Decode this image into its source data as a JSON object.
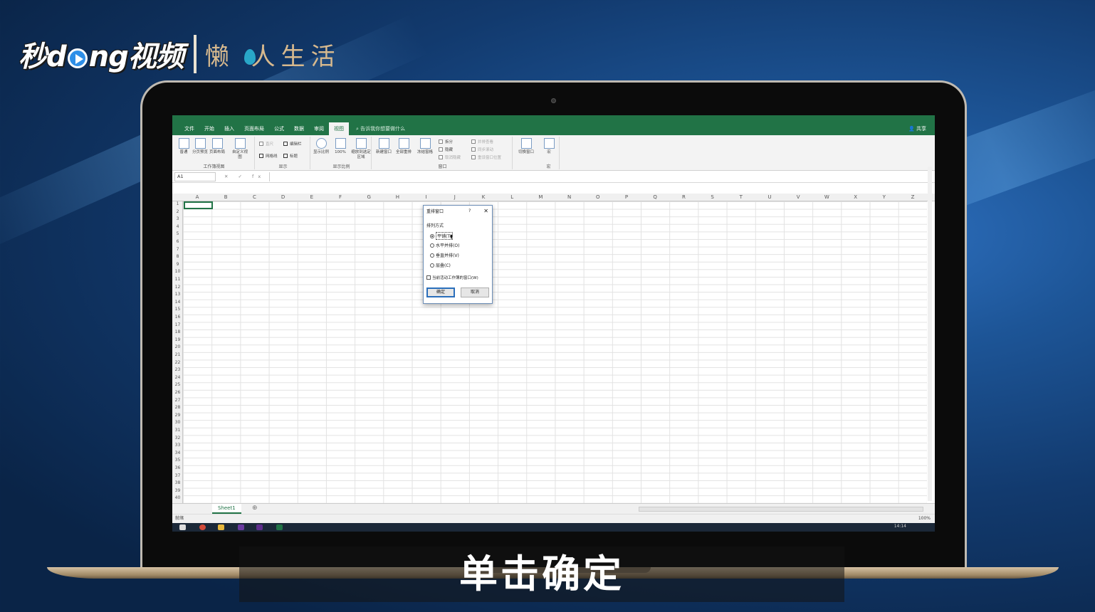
{
  "brand": {
    "main_a": "秒d",
    "main_b": "ng视频",
    "sub_a": "懒",
    "sub_b": "人生活"
  },
  "caption": "单击确定",
  "excel": {
    "tabs": [
      "文件",
      "开始",
      "插入",
      "页面布局",
      "公式",
      "数据",
      "审阅",
      "视图"
    ],
    "active_tab": "视图",
    "tell_me": "告诉我你想要做什么",
    "share": "共享",
    "ribbon": {
      "workbook_views": {
        "label": "工作簿视图",
        "normal": "普通",
        "page_break": "分页预览",
        "page_layout": "页面布局",
        "custom": "自定义视图"
      },
      "show": {
        "label": "显示",
        "ruler": "直尺",
        "formula_bar": "编辑栏",
        "gridlines": "网格线",
        "headings": "标题"
      },
      "zoom": {
        "label": "显示比例",
        "zoom": "显示比例",
        "hundred": "100%",
        "to_selection": "缩放到选定区域"
      },
      "window": {
        "label": "窗口",
        "new_window": "新建窗口",
        "arrange_all": "全部重排",
        "freeze": "冻结窗格",
        "split": "拆分",
        "hide": "隐藏",
        "unhide": "取消隐藏",
        "side_by_side": "并排查看",
        "sync_scroll": "同步滚动",
        "reset_pos": "重设窗口位置",
        "switch": "切换窗口"
      },
      "macros": {
        "label": "宏",
        "macros": "宏"
      }
    },
    "name_box": "A1",
    "formula_icons": "✕ ✓ fx",
    "columns": [
      "A",
      "B",
      "C",
      "D",
      "E",
      "F",
      "G",
      "H",
      "I",
      "J",
      "K",
      "L",
      "M",
      "N",
      "O",
      "P",
      "Q",
      "R",
      "S",
      "T",
      "U",
      "V",
      "W",
      "X",
      "Y",
      "Z"
    ],
    "row_count": 40,
    "sheet_tab": "Sheet1",
    "status": "就绪",
    "zoom": "100%",
    "time": "14:14"
  },
  "dialog": {
    "title": "重排窗口",
    "help": "?",
    "close": "✕",
    "section": "排列方式",
    "options": [
      "平铺(T)",
      "水平并排(O)",
      "垂直并排(V)",
      "层叠(C)"
    ],
    "selected": "平铺(T)",
    "checkbox": "当前活动工作簿的窗口(W)",
    "ok": "确定",
    "cancel": "取消"
  },
  "colors": {
    "excel_green": "#217346",
    "dialog_border": "#6e8fb8",
    "ok_border": "#2a6ebb"
  }
}
